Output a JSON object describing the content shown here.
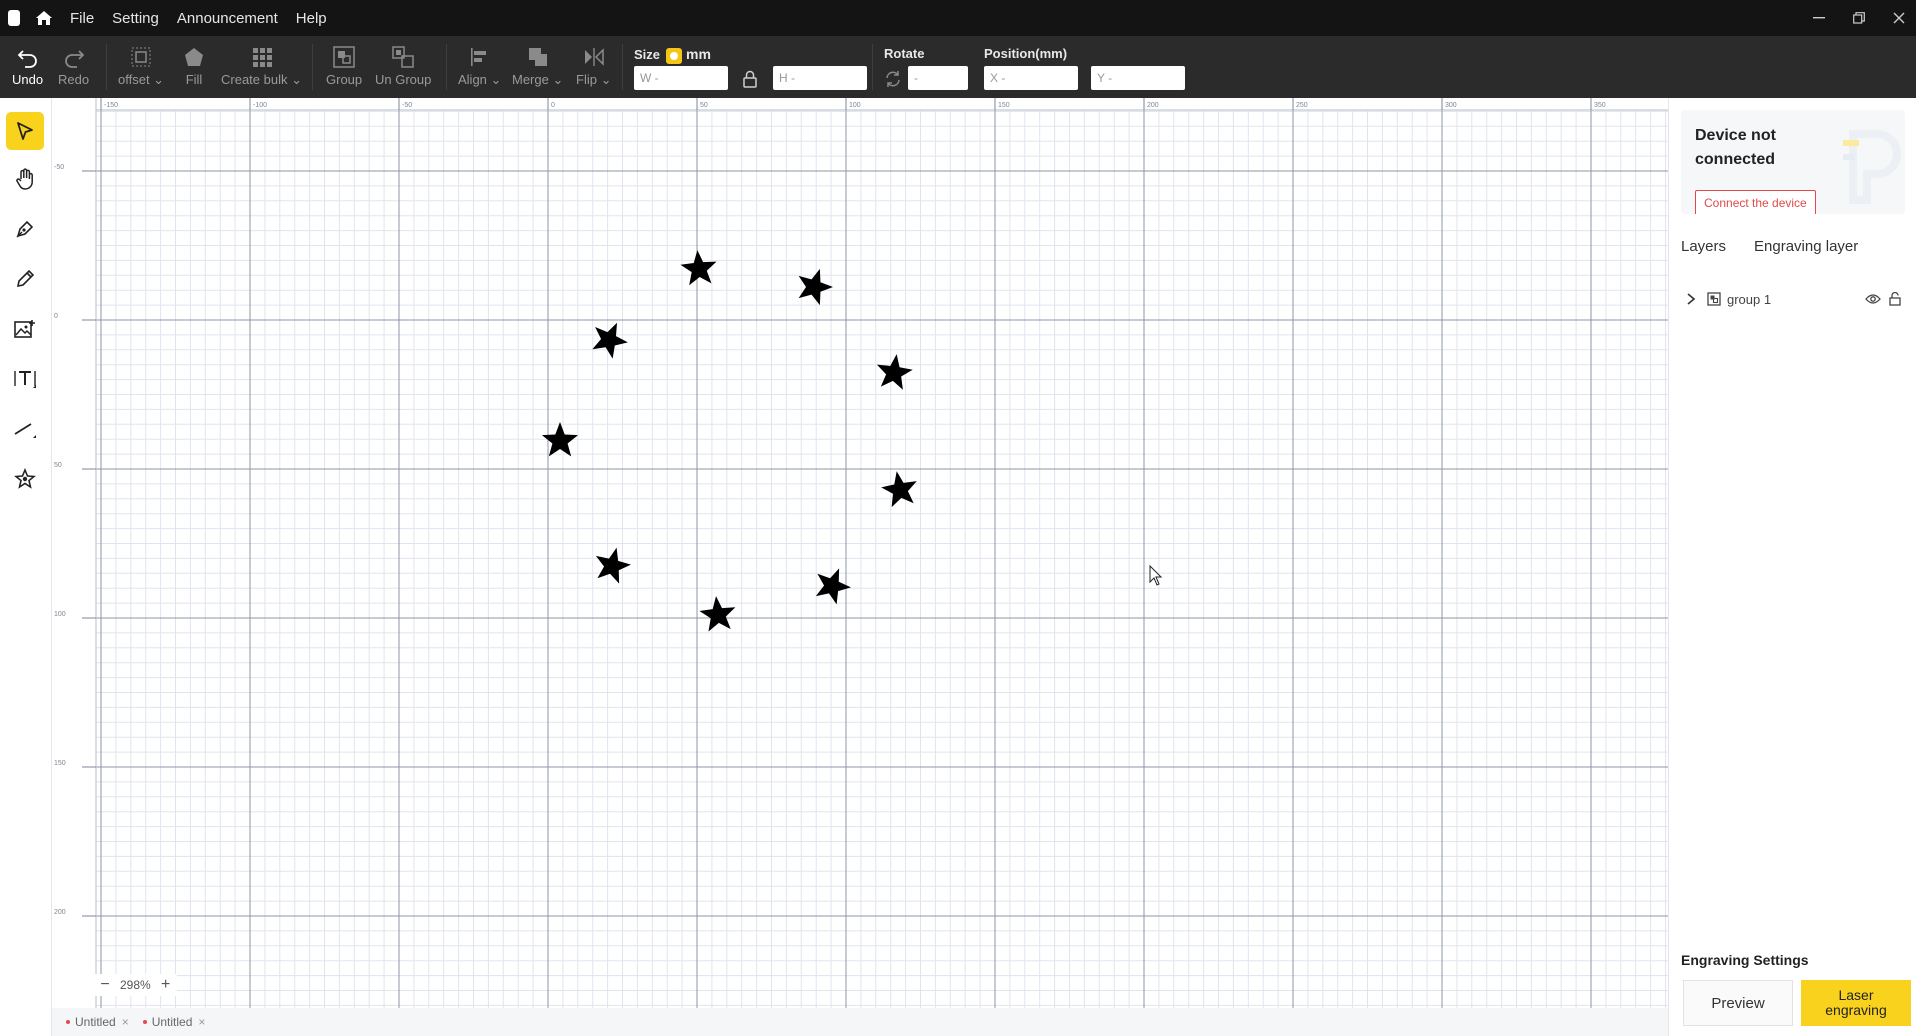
{
  "menu": {
    "items": [
      "File",
      "Setting",
      "Announcement",
      "Help"
    ]
  },
  "toolbar": {
    "undo": "Undo",
    "redo": "Redo",
    "offset": "offset",
    "fill": "Fill",
    "create_bulk": "Create bulk",
    "group": "Group",
    "ungroup": "Un Group",
    "align": "Align",
    "merge": "Merge",
    "flip": "Flip",
    "size_label": "Size",
    "size_unit": "mm",
    "w_placeholder": "W -",
    "h_placeholder": "H -",
    "rotate_label": "Rotate",
    "rotate_value": "-",
    "position_label": "Position(mm)",
    "x_placeholder": "X -",
    "y_placeholder": "Y -"
  },
  "left_tools": [
    "select-icon",
    "hand-icon",
    "pen-icon",
    "pencil-icon",
    "image-add-icon",
    "text-icon",
    "line-icon",
    "shape-star-icon"
  ],
  "ruler": {
    "x_labels": [
      "-150",
      "-100",
      "-50",
      "0",
      "50",
      "100",
      "150",
      "200",
      "250",
      "300",
      "350"
    ],
    "y_labels": [
      "-50",
      "0",
      "50",
      "100",
      "150",
      "200"
    ]
  },
  "zoom": {
    "value": "298%",
    "minus": "−",
    "plus": "+"
  },
  "doc_tabs": [
    "Untitled",
    "Untitled"
  ],
  "right_panel": {
    "device_status": "Device not connected",
    "connect_button": "Connect the device",
    "tabs": [
      "Layers",
      "Engraving layer"
    ],
    "layers": [
      {
        "name": "group 1"
      }
    ],
    "engraving_settings": "Engraving Settings",
    "preview_button": "Preview",
    "laser_button": "Laser engraving"
  },
  "colors": {
    "accent": "#f9d21e",
    "danger": "#e04a4a",
    "titlebar": "#141414",
    "toolbar": "#2b2b2b"
  }
}
